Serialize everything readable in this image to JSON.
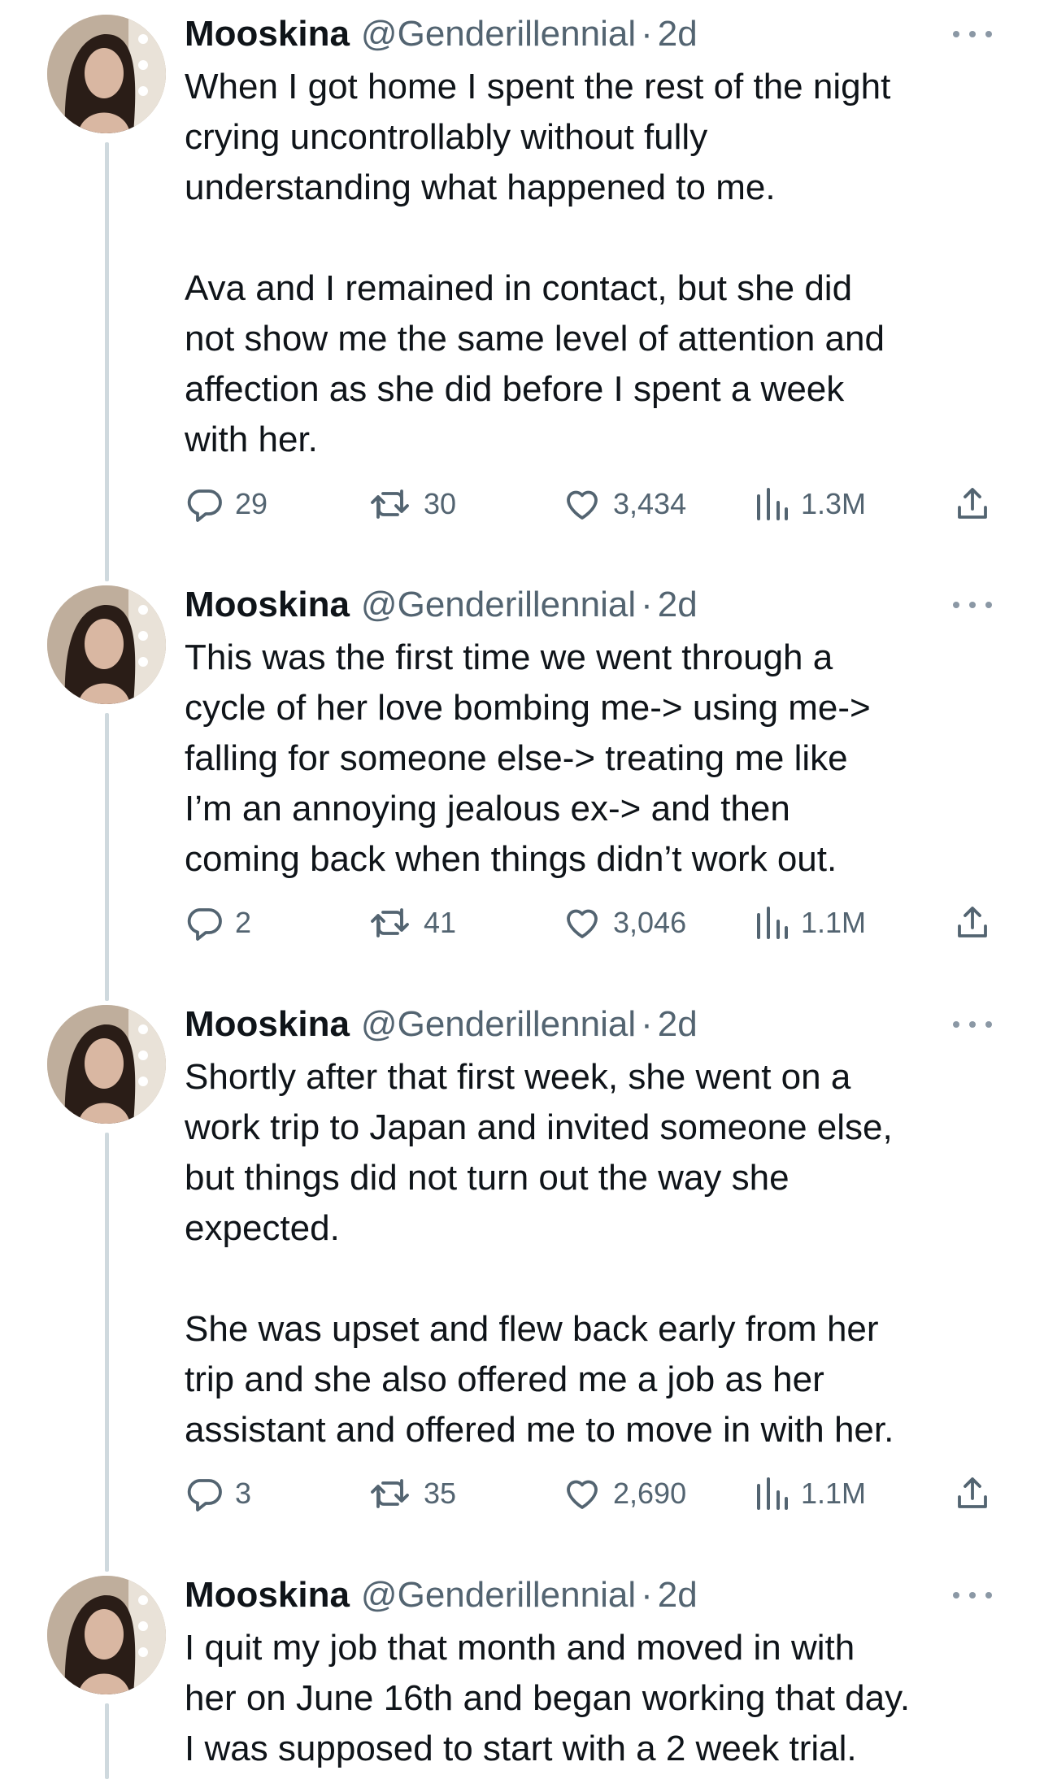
{
  "tweets": [
    {
      "name": "Mooskina",
      "handle": "@Genderillennial",
      "separator": "·",
      "time": "2d",
      "paragraphs": [
        "When I got home I spent the rest of the night\ncrying uncontrollably without fully\nunderstanding what happened to me.",
        "Ava and I remained in contact, but she did\nnot show me the same level of attention and\naffection as she did before I spent a week\nwith her."
      ],
      "replies": "29",
      "retweets": "30",
      "likes": "3,434",
      "views": "1.3M"
    },
    {
      "name": "Mooskina",
      "handle": "@Genderillennial",
      "separator": "·",
      "time": "2d",
      "paragraphs": [
        "This was the first time we went through a\ncycle of  her love bombing me-> using me->\nfalling for someone else-> treating me like\nI’m an annoying jealous ex-> and then\ncoming back when things didn’t work out."
      ],
      "replies": "2",
      "retweets": "41",
      "likes": "3,046",
      "views": "1.1M"
    },
    {
      "name": "Mooskina",
      "handle": "@Genderillennial",
      "separator": "·",
      "time": "2d",
      "paragraphs": [
        "Shortly after that first week, she went on a\nwork trip to Japan and invited someone else,\nbut things did not turn out the way she\nexpected.",
        "She was upset and flew back early from her\ntrip and she also offered me a job as her\nassistant and offered me to move in with her."
      ],
      "replies": "3",
      "retweets": "35",
      "likes": "2,690",
      "views": "1.1M"
    },
    {
      "name": "Mooskina",
      "handle": "@Genderillennial",
      "separator": "·",
      "time": "2d",
      "paragraphs": [
        "I quit my job that month and moved in with\nher on June 16th and began working that day.\nI was supposed to start with a 2 week trial."
      ]
    }
  ],
  "icons": {
    "reply": "reply-icon",
    "retweet": "retweet-icon",
    "like": "like-icon",
    "views": "views-icon",
    "share": "share-icon",
    "more": "more-icon"
  },
  "colors": {
    "text": "#0f1419",
    "secondary": "#536471",
    "thread_line": "#cfd9de",
    "more_dots": "#8b98a5"
  }
}
